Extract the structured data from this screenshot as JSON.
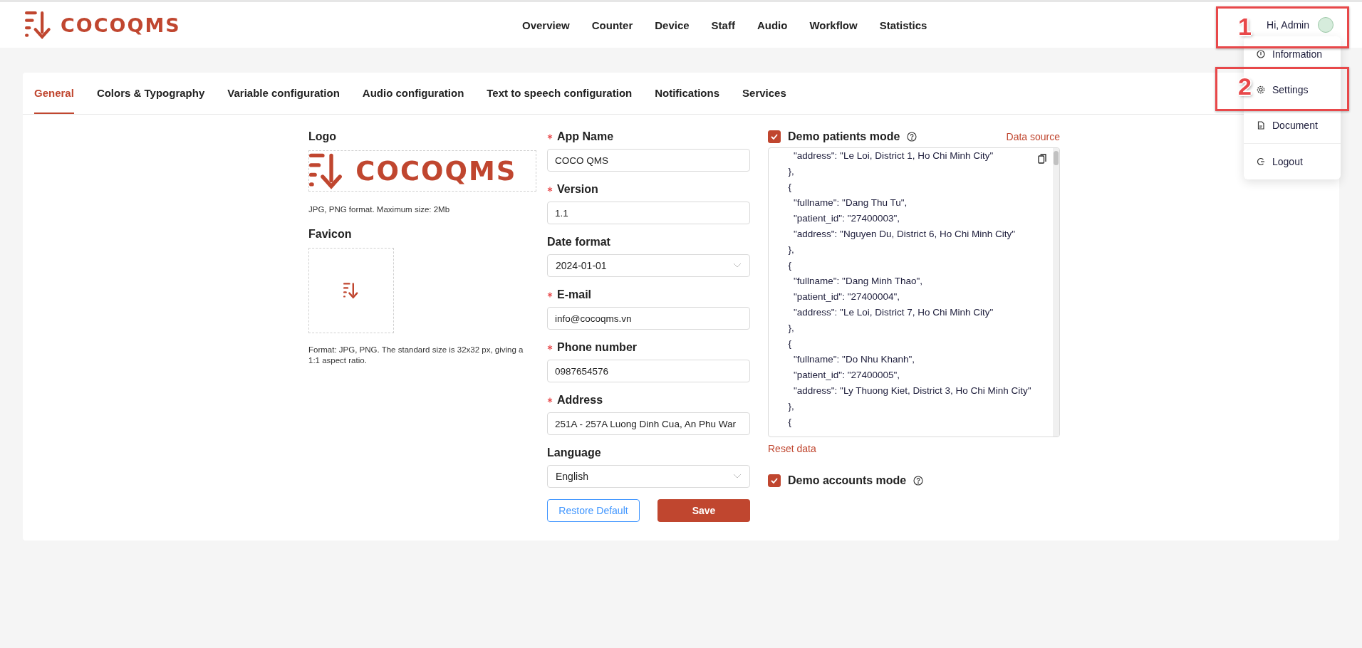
{
  "header": {
    "brand": "COCOQMS",
    "nav": [
      {
        "label": "Overview"
      },
      {
        "label": "Counter"
      },
      {
        "label": "Device"
      },
      {
        "label": "Staff"
      },
      {
        "label": "Audio"
      },
      {
        "label": "Workflow"
      },
      {
        "label": "Statistics"
      }
    ],
    "greeting": "Hi, Admin"
  },
  "user_menu": {
    "items": [
      {
        "label": "Information",
        "kind": "info"
      },
      {
        "label": "Settings",
        "kind": "settings"
      },
      {
        "label": "Document",
        "kind": "document"
      },
      {
        "label": "Logout",
        "kind": "logout"
      }
    ]
  },
  "annotations": [
    {
      "label": "1",
      "kind": "user"
    },
    {
      "label": "2",
      "kind": "settings"
    }
  ],
  "tabs": [
    {
      "label": "General",
      "selected": true
    },
    {
      "label": "Colors & Typography",
      "selected": false
    },
    {
      "label": "Variable configuration",
      "selected": false
    },
    {
      "label": "Audio configuration",
      "selected": false
    },
    {
      "label": "Text to speech configuration",
      "selected": false
    },
    {
      "label": "Notifications",
      "selected": false
    },
    {
      "label": "Services",
      "selected": false
    }
  ],
  "logo": {
    "label": "Logo",
    "brand": "COCOQMS",
    "hint": "JPG, PNG format. Maximum size: 2Mb"
  },
  "favicon": {
    "label": "Favicon",
    "hint": "Format: JPG, PNG. The standard size is 32x32 px, giving a 1:1 aspect ratio."
  },
  "fields": [
    {
      "label": "App Name",
      "required": true,
      "kind": "text",
      "value": "COCO QMS"
    },
    {
      "label": "Version",
      "required": true,
      "kind": "text",
      "value": "1.1"
    },
    {
      "label": "Date format",
      "required": false,
      "kind": "select",
      "value": "2024-01-01"
    },
    {
      "label": "E-mail",
      "required": true,
      "kind": "text",
      "value": "info@cocoqms.vn"
    },
    {
      "label": "Phone number",
      "required": true,
      "kind": "text",
      "value": "0987654576"
    },
    {
      "label": "Address",
      "required": true,
      "kind": "text",
      "value": "251A - 257A Luong Dinh Cua, An Phu War"
    },
    {
      "label": "Language",
      "required": false,
      "kind": "select",
      "value": "English"
    }
  ],
  "buttons": {
    "restore": "Restore Default",
    "save": "Save"
  },
  "demo_patients": {
    "label": "Demo patients mode",
    "checked": true,
    "link": "Data source",
    "reset": "Reset data",
    "code_lines": [
      "    \"address\": \"Le Loi, District 1, Ho Chi Minh City\"",
      "  },",
      "  {",
      "    \"fullname\": \"Dang Thu Tu\",",
      "    \"patient_id\": \"27400003\",",
      "    \"address\": \"Nguyen Du, District 6, Ho Chi Minh City\"",
      "  },",
      "  {",
      "    \"fullname\": \"Dang Minh Thao\",",
      "    \"patient_id\": \"27400004\",",
      "    \"address\": \"Le Loi, District 7, Ho Chi Minh City\"",
      "  },",
      "  {",
      "    \"fullname\": \"Do Nhu Khanh\",",
      "    \"patient_id\": \"27400005\",",
      "    \"address\": \"Ly Thuong Kiet, District 3, Ho Chi Minh City\"",
      "  },",
      "  {"
    ]
  },
  "demo_accounts": {
    "label": "Demo accounts mode",
    "checked": true
  }
}
